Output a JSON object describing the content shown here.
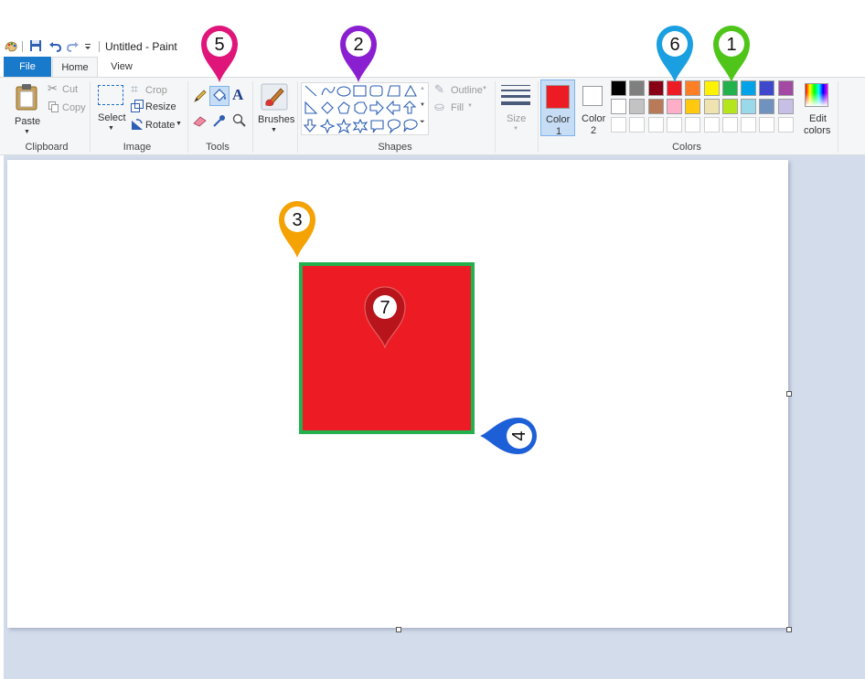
{
  "window": {
    "title": "Untitled - Paint"
  },
  "tabs": {
    "file": "File",
    "home": "Home",
    "view": "View"
  },
  "clipboard": {
    "paste": "Paste",
    "cut": "Cut",
    "copy": "Copy",
    "group_label": "Clipboard"
  },
  "image": {
    "select": "Select",
    "crop": "Crop",
    "resize": "Resize",
    "rotate": "Rotate",
    "group_label": "Image"
  },
  "tools": {
    "group_label": "Tools"
  },
  "brushes": {
    "label": "Brushes"
  },
  "shapes": {
    "outline": "Outline",
    "fill": "Fill",
    "group_label": "Shapes"
  },
  "size": {
    "label": "Size"
  },
  "colors": {
    "color1": "Color\n1",
    "color1_line1": "Color",
    "color1_line2": "1",
    "color2_line1": "Color",
    "color2_line2": "2",
    "edit_line1": "Edit",
    "edit_line2": "colors",
    "group_label": "Colors",
    "color1_value": "#ed1c24",
    "color2_value": "#ffffff",
    "palette_row1": [
      "#000000",
      "#7f7f7f",
      "#880015",
      "#ed1c24",
      "#ff7f27",
      "#fff200",
      "#22b14c",
      "#00a2e8",
      "#3f48cc",
      "#a349a4"
    ],
    "palette_row2": [
      "#ffffff",
      "#c3c3c3",
      "#b97a57",
      "#ffaec9",
      "#ffc90e",
      "#efe4b0",
      "#b5e61d",
      "#99d9ea",
      "#7092be",
      "#c8bfe7"
    ]
  },
  "canvas": {
    "shape_fill": "#ed1c24",
    "shape_outline": "#22b14c"
  },
  "markers": [
    {
      "label": "1",
      "color": "#4fc51a"
    },
    {
      "label": "2",
      "color": "#8a1fd1"
    },
    {
      "label": "3",
      "color": "#f5a205"
    },
    {
      "label": "4",
      "color": "#1d5fd6"
    },
    {
      "label": "5",
      "color": "#e0157a"
    },
    {
      "label": "6",
      "color": "#1a9fe0"
    },
    {
      "label": "7",
      "color": "#b8141b"
    }
  ]
}
